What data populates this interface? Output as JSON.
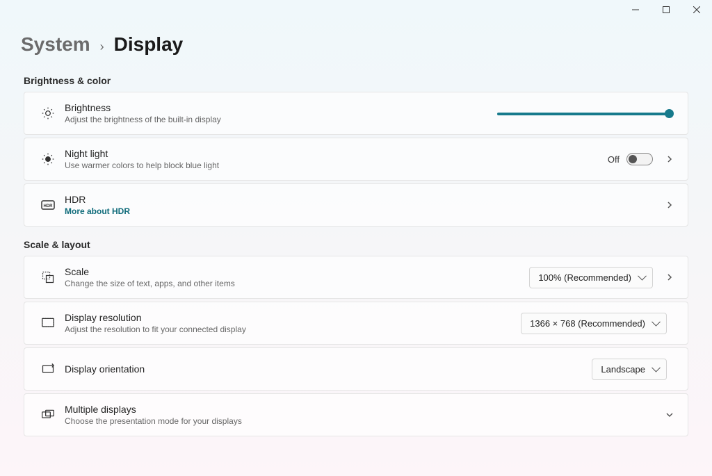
{
  "breadcrumb": {
    "parent": "System",
    "current": "Display"
  },
  "sections": {
    "brightnessColor": {
      "label": "Brightness & color",
      "brightness": {
        "title": "Brightness",
        "desc": "Adjust the brightness of the built-in display",
        "value_percent": 100
      },
      "nightLight": {
        "title": "Night light",
        "desc": "Use warmer colors to help block blue light",
        "state_label": "Off",
        "enabled": false
      },
      "hdr": {
        "title": "HDR",
        "link": "More about HDR"
      }
    },
    "scaleLayout": {
      "label": "Scale & layout",
      "scale": {
        "title": "Scale",
        "desc": "Change the size of text, apps, and other items",
        "value": "100% (Recommended)"
      },
      "resolution": {
        "title": "Display resolution",
        "desc": "Adjust the resolution to fit your connected display",
        "value": "1366 × 768 (Recommended)"
      },
      "orientation": {
        "title": "Display orientation",
        "value": "Landscape"
      },
      "multiple": {
        "title": "Multiple displays",
        "desc": "Choose the presentation mode for your displays"
      }
    }
  },
  "colors": {
    "accent": "#177a8c"
  }
}
